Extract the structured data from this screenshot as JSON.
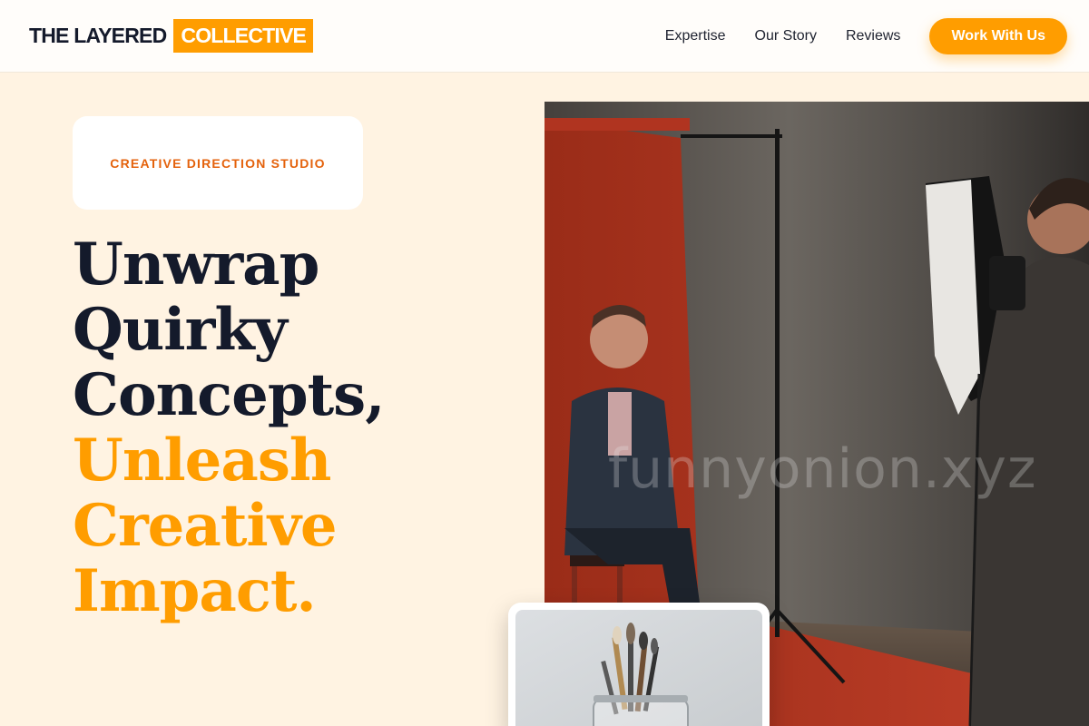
{
  "header": {
    "logo_part1": "THE LAYERED",
    "logo_part2": "COLLECTIVE",
    "nav": [
      "Expertise",
      "Our Story",
      "Reviews"
    ],
    "cta_label": "Work With Us"
  },
  "hero": {
    "tagline": "CREATIVE DIRECTION STUDIO",
    "headline_lines_dark": [
      "Unwrap",
      "Quirky",
      "Concepts,"
    ],
    "headline_lines_accent": [
      "Unleash",
      "Creative",
      "Impact."
    ],
    "photo_watermark": "funnyonion.xyz"
  },
  "colors": {
    "accent": "#ff9d00",
    "tagline": "#e4620c",
    "heading": "#141a2b",
    "background": "#fff3e2"
  }
}
